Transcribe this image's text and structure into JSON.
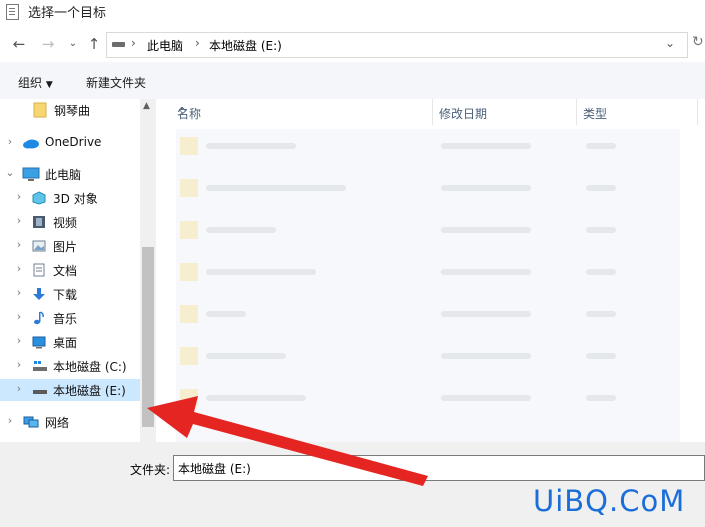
{
  "window": {
    "title": "选择一个目标"
  },
  "address_bar": {
    "crumbs": [
      "此电脑",
      "本地磁盘 (E:)"
    ]
  },
  "toolbar": {
    "organize_label": "组织",
    "new_folder_label": "新建文件夹"
  },
  "sidebar": {
    "items": [
      {
        "label": "钢琴曲",
        "icon": "folder-icon"
      },
      {
        "label": "OneDrive",
        "icon": "onedrive-cloud-icon"
      },
      {
        "label": "此电脑",
        "icon": "computer-icon"
      },
      {
        "label": "3D 对象",
        "icon": "3d-objects-icon"
      },
      {
        "label": "视频",
        "icon": "video-icon"
      },
      {
        "label": "图片",
        "icon": "pictures-icon"
      },
      {
        "label": "文档",
        "icon": "documents-icon"
      },
      {
        "label": "下载",
        "icon": "download-icon"
      },
      {
        "label": "音乐",
        "icon": "music-icon"
      },
      {
        "label": "桌面",
        "icon": "desktop-icon"
      },
      {
        "label": "本地磁盘 (C:)",
        "icon": "system-drive-icon"
      },
      {
        "label": "本地磁盘 (E:)",
        "icon": "drive-icon",
        "selected": true
      },
      {
        "label": "网络",
        "icon": "network-icon"
      }
    ]
  },
  "file_list": {
    "columns": [
      "名称",
      "修改日期",
      "类型"
    ]
  },
  "footer": {
    "folder_label": "文件夹:",
    "folder_value": "本地磁盘 (E:)"
  },
  "watermark": "UiBQ.CoM",
  "colors": {
    "selection": "#cce8ff",
    "arrow": "#e52521",
    "watermark": "#1a6ed8"
  }
}
